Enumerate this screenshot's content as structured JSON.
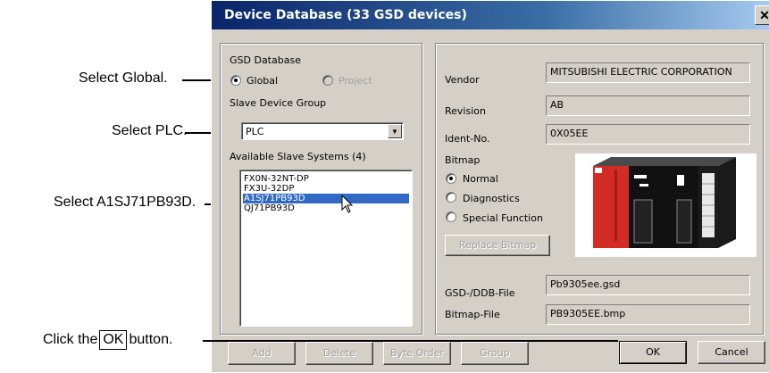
{
  "callouts": {
    "global": "Select Global.",
    "plc": "Select PLC.",
    "slave": "Select A1SJ71PB93D.",
    "ok_prefix": "Click the",
    "ok_box": "OK",
    "ok_suffix": "button."
  },
  "dialog": {
    "title": "Device Database (33 GSD devices)",
    "close_glyph": "✕",
    "gsd_database_label": "GSD Database",
    "radio_global": "Global",
    "radio_project": "Project",
    "slave_group_label": "Slave Device Group",
    "slave_group_value": "PLC",
    "available_label": "Available Slave Systems (4)",
    "slaves": [
      "FX0N-32NT-DP",
      "FX3U-32DP",
      "A1SJ71PB93D",
      "QJ71PB93D"
    ],
    "selected_slave": "A1SJ71PB93D",
    "vendor_label": "Vendor",
    "vendor_value": "MITSUBISHI ELECTRIC CORPORATION",
    "revision_label": "Revision",
    "revision_value": "AB",
    "ident_label": "Ident-No.",
    "ident_value": "0X05EE",
    "bitmap_label": "Bitmap",
    "bitmap_normal": "Normal",
    "bitmap_diagnostics": "Diagnostics",
    "bitmap_special": "Special Function",
    "replace_bitmap": "Replace Bitmap",
    "gsd_file_label": "GSD-/DDB-File",
    "gsd_file_value": "Pb9305ee.gsd",
    "bitmap_file_label": "Bitmap-File",
    "bitmap_file_value": "PB9305EE.bmp",
    "btn_add": "Add",
    "btn_delete": "Delete",
    "btn_byte_order": "Byte Order",
    "btn_group": "Group",
    "btn_ok": "OK",
    "btn_cancel": "Cancel"
  },
  "colors": {
    "selection": "#316ac5",
    "title_start": "#0a246a",
    "title_end": "#a6caf0",
    "plc_red": "#d32b26"
  }
}
